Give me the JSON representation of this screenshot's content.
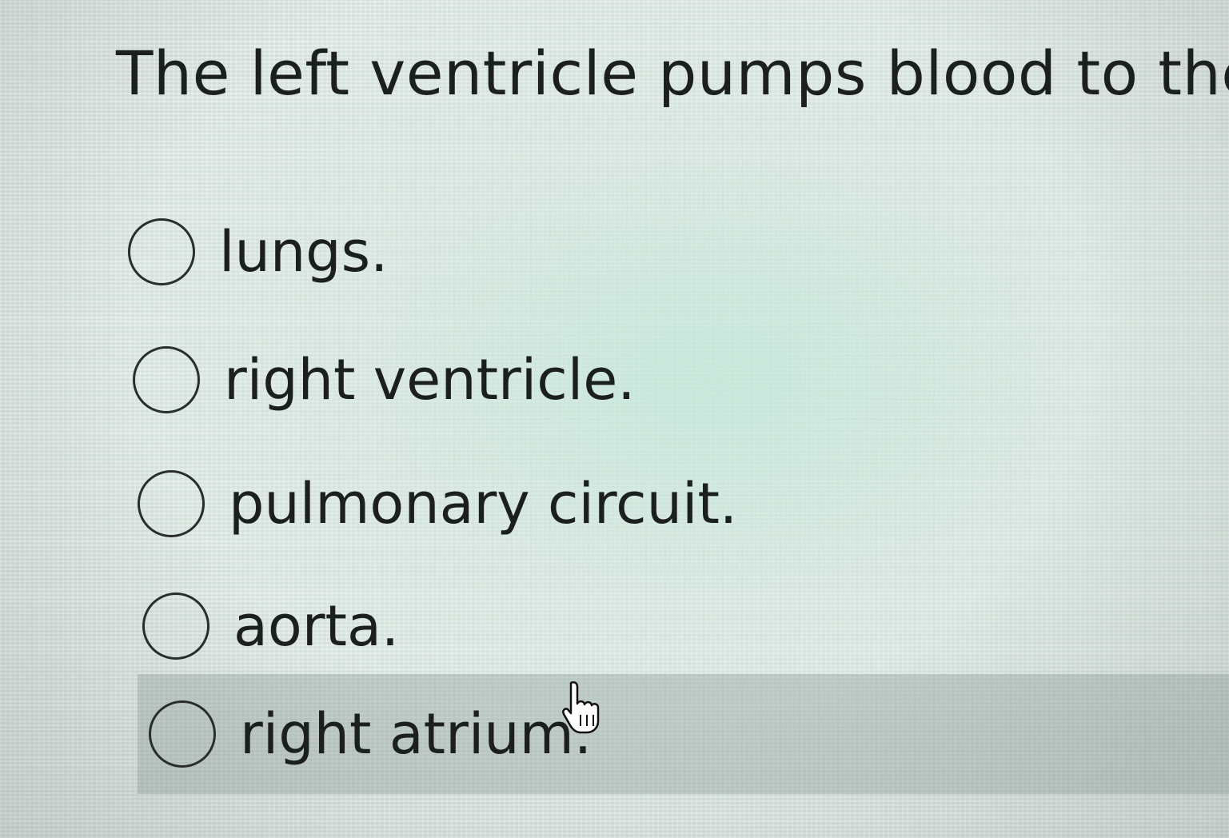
{
  "question": {
    "text": "The left ventricle pumps blood to the"
  },
  "options": [
    {
      "label": "lungs.",
      "selected": false,
      "hovered": false
    },
    {
      "label": "right ventricle.",
      "selected": false,
      "hovered": false
    },
    {
      "label": "pulmonary circuit.",
      "selected": false,
      "hovered": false
    },
    {
      "label": "aorta.",
      "selected": false,
      "hovered": false
    },
    {
      "label": "right atrium.",
      "selected": false,
      "hovered": true
    }
  ],
  "cursor": {
    "icon": "hand-pointer-icon"
  },
  "colors": {
    "text": "#1c1f1f",
    "radio_border": "#2a2d2d",
    "hover_row": "#9aa8a3"
  }
}
